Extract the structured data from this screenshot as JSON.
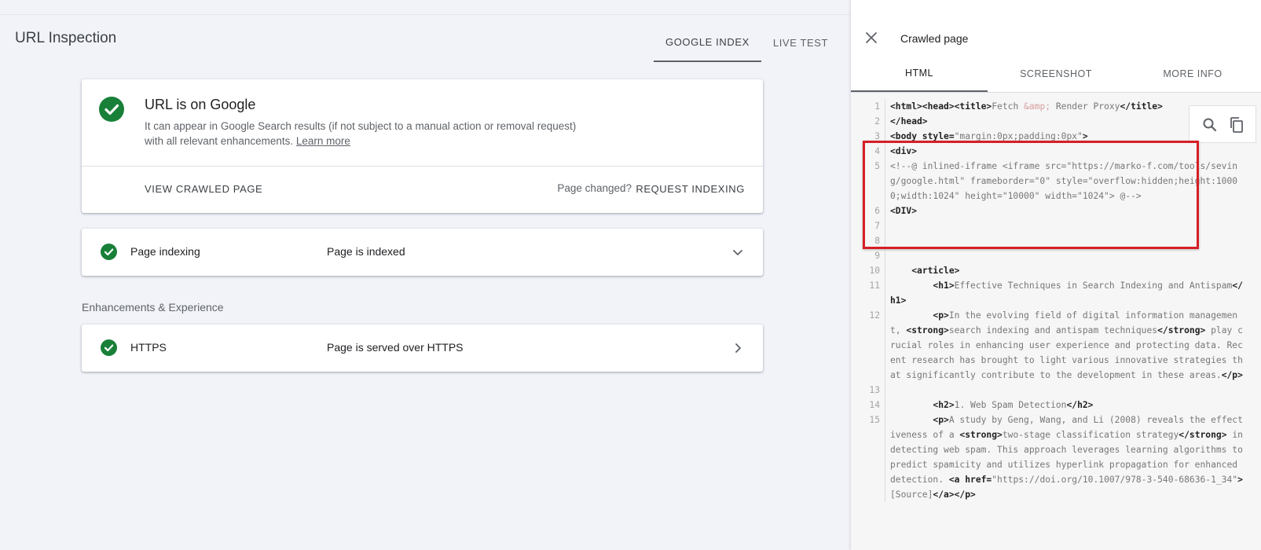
{
  "header": {
    "title": "URL Inspection",
    "tabs": [
      {
        "label": "GOOGLE INDEX"
      },
      {
        "label": "LIVE TEST"
      }
    ]
  },
  "status_card": {
    "icon": "check-circle-icon",
    "title": "URL is on Google",
    "description": "It can appear in Google Search results (if not subject to a manual action or removal request) with all relevant enhancements.",
    "learn_more": "Learn more",
    "view_crawled": "VIEW CRAWLED PAGE",
    "page_changed": "Page changed?",
    "request_indexing": "REQUEST INDEXING"
  },
  "page_indexing": {
    "label": "Page indexing",
    "value": "Page is indexed"
  },
  "enhancements": {
    "section_label": "Enhancements & Experience",
    "https_label": "HTTPS",
    "https_value": "Page is served over HTTPS"
  },
  "panel": {
    "title": "Crawled page",
    "tabs": [
      {
        "label": "HTML"
      },
      {
        "label": "SCREENSHOT"
      },
      {
        "label": "MORE INFO"
      }
    ]
  },
  "code": {
    "line_numbers": [
      "1",
      "2",
      "3",
      "4",
      "5",
      "6",
      "7",
      "8",
      "9",
      "10",
      "11",
      "12",
      "13",
      "14",
      "15"
    ],
    "lines": [
      "<b>&lt;html&gt;&lt;head&gt;&lt;title&gt;</b>Fetch <span class=\"ent\">&amp;amp;</span> Render Proxy<b>&lt;/title&gt;</b>",
      "<b>&lt;/head&gt;</b>",
      "<b>&lt;body style=</b><span class=\"str\">\"margin:0px;padding:0px\"</span><b>&gt;</b>",
      "<b>&lt;div&gt;</b>",
      "&lt;!--@ inlined-iframe &lt;iframe src=\"https://marko-f.com/tools/seving/google.html\" frameborder=\"0\" style=\"overflow:hidden;height:10000;width:1024\" height=\"10000\" width=\"1024\"&gt; @--&gt;",
      "<b>&lt;DIV&gt;</b>",
      "",
      "",
      "",
      "    <b>&lt;article&gt;</b>",
      "        <b>&lt;h1&gt;</b>Effective Techniques in Search Indexing and Antispam<b>&lt;/h1&gt;</b>",
      "        <b>&lt;p&gt;</b>In the evolving field of digital information management, <b>&lt;strong&gt;</b>search indexing and antispam techniques<b>&lt;/strong&gt;</b> play crucial roles in enhancing user experience and protecting data. Recent research has brought to light various innovative strategies that significantly contribute to the development in these areas.<b>&lt;/p&gt;</b>",
      "",
      "        <b>&lt;h2&gt;</b>1. Web Spam Detection<b>&lt;/h2&gt;</b>",
      "        <b>&lt;p&gt;</b>A study by Geng, Wang, and Li (2008) reveals the effectiveness of a <b>&lt;strong&gt;</b>two-stage classification strategy<b>&lt;/strong&gt;</b> in detecting web spam. This approach leverages learning algorithms to predict spamicity and utilizes hyperlink propagation for enhanced detection. <b>&lt;a href=</b>\"https://doi.org/10.1007/978-3-540-68636-1_34\"<b>&gt;</b>[Source]<b>&lt;/a&gt;&lt;/p&gt;</b>"
    ]
  },
  "tools": {
    "search_icon": "search-icon",
    "copy_icon": "copy-icon"
  },
  "colors": {
    "success_green": "#188038",
    "highlight_red": "#d61f26",
    "background": "#f1f3f9"
  }
}
